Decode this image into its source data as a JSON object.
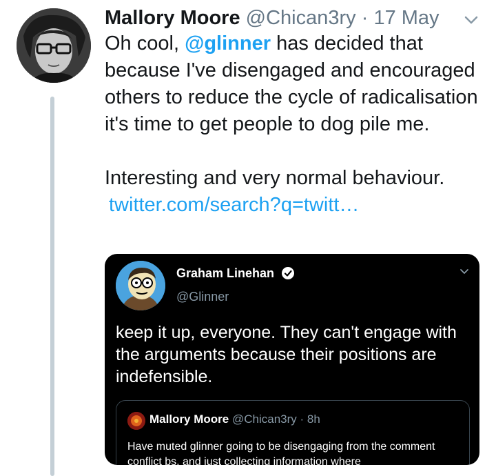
{
  "tweet": {
    "author_name": "Mallory Moore",
    "author_handle": "@Chican3ry",
    "separator": " · ",
    "date": "17 May",
    "text_before_mention": "Oh cool, ",
    "mention": "@glinner",
    "text_after_mention": " has decided that because I've disengaged and encouraged others to reduce the cycle of radicalisation it's time to get people to dog pile me.",
    "text_second_paragraph": "Interesting and very normal behaviour.",
    "link": "twitter.com/search?q=twitt…",
    "menu_icon": "chevron-down-icon",
    "avatar_icon": "profile-photo",
    "accent_color": "#1da1f2"
  },
  "embedded_tweet": {
    "author_name": "Graham Linehan",
    "author_handle": "@Glinner",
    "verified_icon": "verified-badge-icon",
    "menu_icon": "chevron-down-icon",
    "text": "keep it up, everyone. They can't engage with the arguments because their positions are indefensible.",
    "background": "#000000",
    "quoted": {
      "author_name": "Mallory Moore",
      "author_handle": "@Chican3ry",
      "separator": " · ",
      "time": "8h",
      "text": "Have muted glinner going to be disengaging from the comment conflict bs, and just collecting information where"
    }
  }
}
